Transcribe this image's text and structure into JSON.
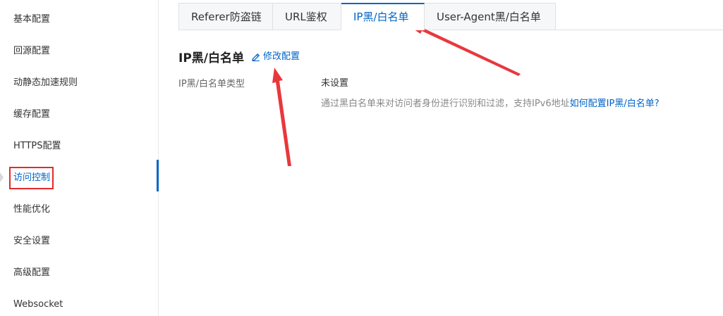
{
  "sidebar": {
    "items": [
      {
        "label": "基本配置"
      },
      {
        "label": "回源配置"
      },
      {
        "label": "动静态加速规则"
      },
      {
        "label": "缓存配置"
      },
      {
        "label": "HTTPS配置"
      },
      {
        "label": "访问控制"
      },
      {
        "label": "性能优化"
      },
      {
        "label": "安全设置"
      },
      {
        "label": "高级配置"
      },
      {
        "label": "Websocket"
      }
    ],
    "active_item": "访问控制"
  },
  "tabs": [
    {
      "label": "Referer防盗链"
    },
    {
      "label": "URL鉴权"
    },
    {
      "label": "IP黑/白名单"
    },
    {
      "label": "User-Agent黑/白名单"
    }
  ],
  "active_tab": "IP黑/白名单",
  "section": {
    "title": "IP黑/白名单",
    "edit_label": "修改配置",
    "edit_icon": "pencil-icon",
    "field_label": "IP黑/白名单类型",
    "field_value": "未设置",
    "help_text": "通过黑白名单来对访问者身份进行识别和过滤，支持IPv6地址",
    "help_link": "如何配置IP黑/白名单?"
  },
  "colors": {
    "accent": "#0064c8",
    "annotation": "#e02b2b"
  }
}
